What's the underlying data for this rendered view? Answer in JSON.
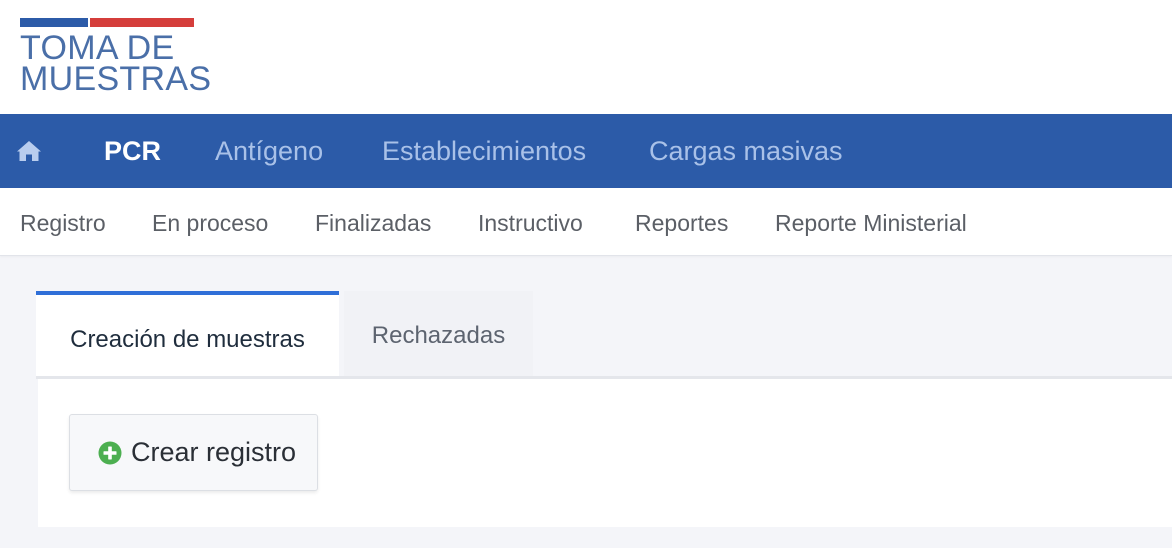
{
  "logo": {
    "line1": "TOMA DE",
    "line2": "MUESTRAS",
    "flag_colors": {
      "blue": "#2c5ba8",
      "red": "#d53e3b"
    }
  },
  "main_nav": {
    "home_icon": "home-icon",
    "items": [
      {
        "label": "PCR",
        "active": true
      },
      {
        "label": "Antígeno",
        "active": false
      },
      {
        "label": "Establecimientos",
        "active": false
      },
      {
        "label": "Cargas masivas",
        "active": false
      }
    ]
  },
  "sub_nav": {
    "items": [
      {
        "label": "Registro"
      },
      {
        "label": "En proceso"
      },
      {
        "label": "Finalizadas"
      },
      {
        "label": "Instructivo"
      },
      {
        "label": "Reportes"
      },
      {
        "label": "Reporte Ministerial"
      }
    ]
  },
  "tabs": [
    {
      "label": "Creación de muestras",
      "active": true
    },
    {
      "label": "Rechazadas",
      "active": false
    }
  ],
  "panel": {
    "create_button": {
      "label": "Crear registro",
      "icon": "plus-circle-icon"
    }
  },
  "colors": {
    "nav_bg": "#2c5ba8",
    "active_tab_accent": "#2f6fd8",
    "plus_icon": "#4caf50"
  }
}
